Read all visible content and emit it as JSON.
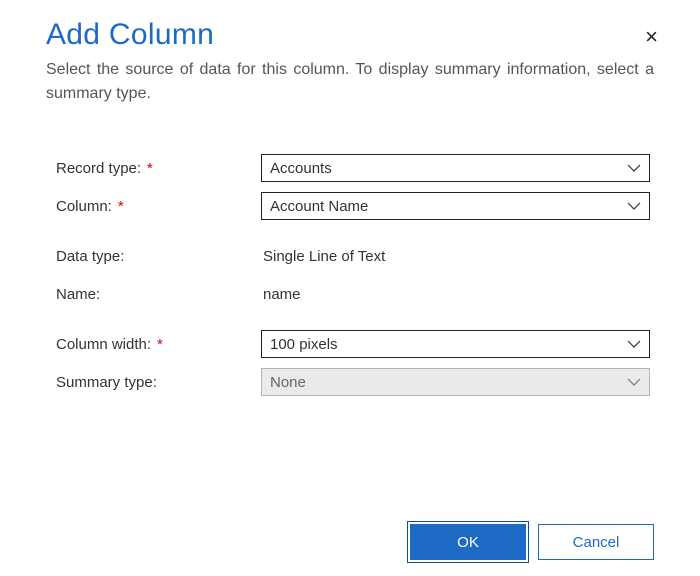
{
  "dialog": {
    "title": "Add Column",
    "subtitle": "Select the source of data for this column. To display summary information, select a summary type.",
    "close_label": "×"
  },
  "form": {
    "record_type": {
      "label": "Record type:",
      "value": "Accounts",
      "required": true
    },
    "column": {
      "label": "Column:",
      "value": "Account Name",
      "required": true
    },
    "data_type": {
      "label": "Data type:",
      "value": "Single Line of Text"
    },
    "name": {
      "label": "Name:",
      "value": "name"
    },
    "column_width": {
      "label": "Column width:",
      "value": "100 pixels",
      "required": true
    },
    "summary_type": {
      "label": "Summary type:",
      "value": "None",
      "disabled": true
    }
  },
  "buttons": {
    "ok": "OK",
    "cancel": "Cancel"
  },
  "required_marker": "*"
}
